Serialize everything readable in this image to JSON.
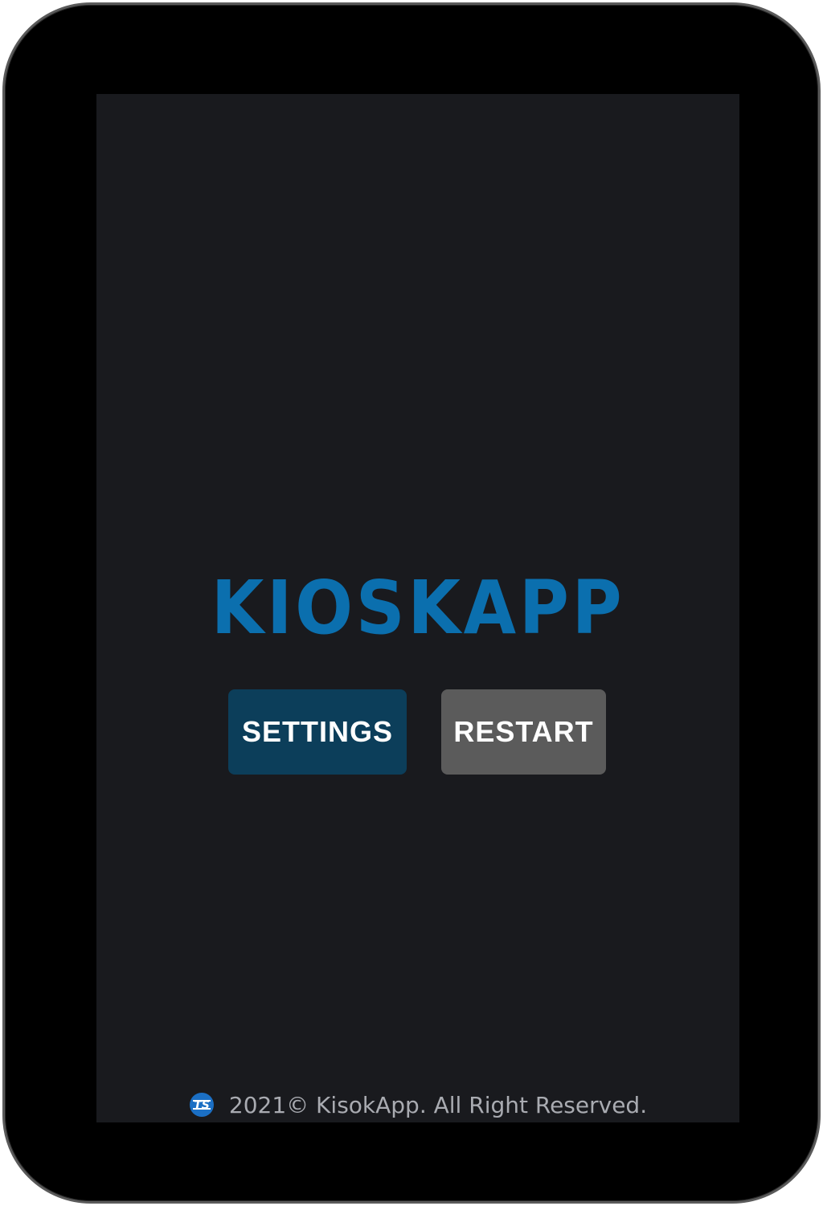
{
  "app": {
    "logo_text": "KIOSKAPP"
  },
  "actions": {
    "settings_label": "SETTINGS",
    "restart_label": "RESTART"
  },
  "footer": {
    "copyright": "2021© KisokApp. All Right Reserved.",
    "logo_icon": "ts-logo-icon"
  },
  "colors": {
    "screen_background": "#191a1e",
    "logo_blue": "#0b6fae",
    "settings_button": "#0c3e5a",
    "restart_button": "#5b5b5b",
    "footer_text": "#a9abb1"
  }
}
